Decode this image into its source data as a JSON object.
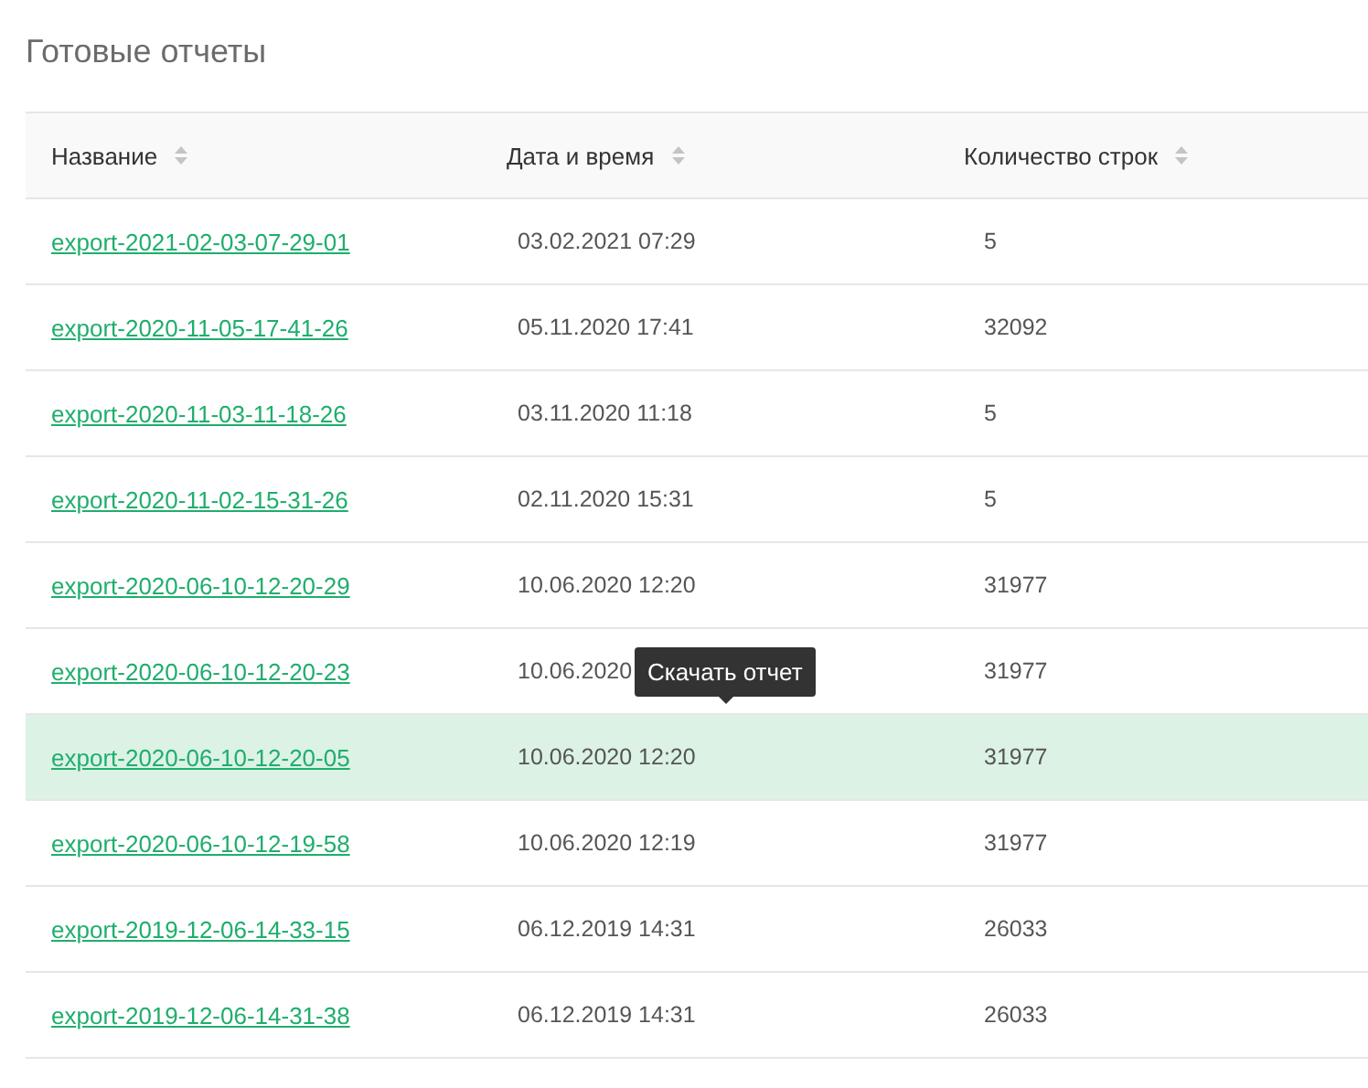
{
  "title": "Готовые отчеты",
  "table": {
    "columns": [
      {
        "label": "Название"
      },
      {
        "label": "Дата и время"
      },
      {
        "label": "Количество строк"
      }
    ],
    "rows": [
      {
        "name": "export-2021-02-03-07-29-01",
        "date": "03.02.2021 07:29",
        "count": "5",
        "selected": false
      },
      {
        "name": "export-2020-11-05-17-41-26",
        "date": "05.11.2020 17:41",
        "count": "32092",
        "selected": false
      },
      {
        "name": "export-2020-11-03-11-18-26",
        "date": "03.11.2020 11:18",
        "count": "5",
        "selected": false
      },
      {
        "name": "export-2020-11-02-15-31-26",
        "date": "02.11.2020 15:31",
        "count": "5",
        "selected": false
      },
      {
        "name": "export-2020-06-10-12-20-29",
        "date": "10.06.2020 12:20",
        "count": "31977",
        "selected": false
      },
      {
        "name": "export-2020-06-10-12-20-23",
        "date": "10.06.2020",
        "count": "31977",
        "selected": false
      },
      {
        "name": "export-2020-06-10-12-20-05",
        "date": "10.06.2020 12:20",
        "count": "31977",
        "selected": true
      },
      {
        "name": "export-2020-06-10-12-19-58",
        "date": "10.06.2020 12:19",
        "count": "31977",
        "selected": false
      },
      {
        "name": "export-2019-12-06-14-33-15",
        "date": "06.12.2019 14:31",
        "count": "26033",
        "selected": false
      },
      {
        "name": "export-2019-12-06-14-31-38",
        "date": "06.12.2019 14:31",
        "count": "26033",
        "selected": false
      }
    ]
  },
  "tooltip": {
    "text": "Скачать отчет"
  }
}
